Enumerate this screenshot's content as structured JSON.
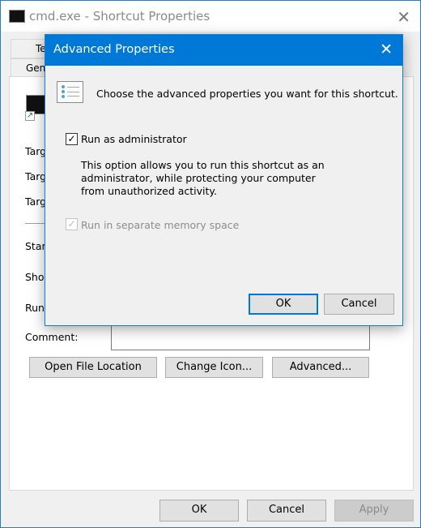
{
  "window": {
    "title": "cmd.exe - Shortcut Properties",
    "close": "✕"
  },
  "tabs": [
    "Te",
    "Gen"
  ],
  "fields": [
    "Targ",
    "Targ",
    "Targ",
    "Start",
    "Shor",
    "Run:",
    "Comment:"
  ],
  "buttons": {
    "open_file_location": "Open File Location",
    "change_icon": "Change Icon...",
    "advanced": "Advanced..."
  },
  "footer": {
    "ok": "OK",
    "cancel": "Cancel",
    "apply": "Apply"
  },
  "dialog": {
    "title": "Advanced Properties",
    "close": "✕",
    "intro": "Choose the advanced properties you want for this shortcut.",
    "run_as_admin": {
      "label": "Run as administrator",
      "checked": true
    },
    "description": "This option allows you to run this shortcut as an administrator, while protecting your computer from unauthorized activity.",
    "separate_memory": {
      "label": "Run in separate memory space",
      "checked": true,
      "disabled": true
    },
    "ok": "OK",
    "cancel": "Cancel",
    "check": "✓"
  },
  "colors": {
    "accent": "#0078d7"
  }
}
